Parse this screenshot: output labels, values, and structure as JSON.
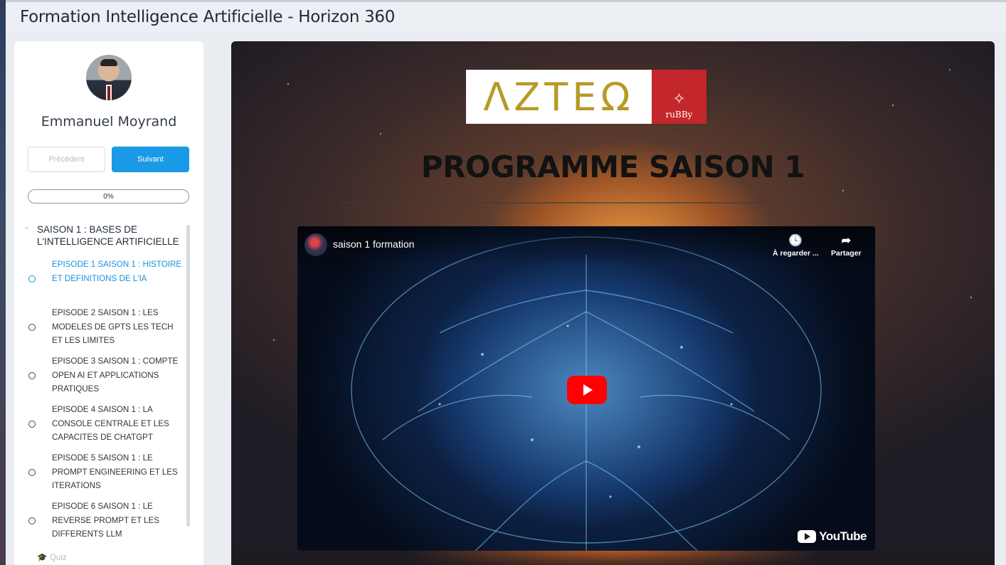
{
  "page": {
    "title": "Formation Intelligence Artificielle - Horizon 360"
  },
  "sidebar": {
    "user_name": "Emmanuel Moyrand",
    "prev_label": "Précédent",
    "next_label": "Suivant",
    "progress": {
      "label": "0%",
      "value": 0
    },
    "section": {
      "title": "SAISON 1 : BASES DE L'INTELLIGENCE ARTIFICIELLE",
      "caret": "ˆ",
      "episodes": [
        {
          "label": "EPISODE 1 SAISON 1 : HISTOIRE ET DEFINITIONS DE L'IA",
          "active": true
        },
        {
          "label": "EPISODE 2 SAISON 1 : LES MODELES DE GPTS LES TECH ET LES LIMITES",
          "active": false
        },
        {
          "label": "EPISODE 3 SAISON 1 : COMPTE OPEN AI ET APPLICATIONS PRATIQUES",
          "active": false
        },
        {
          "label": "EPISODE 4 SAISON 1 : LA CONSOLE CENTRALE ET LES CAPACITES DE CHATGPT",
          "active": false
        },
        {
          "label": "EPISODE 5 SAISON 1 : LE PROMPT ENGINEERING ET LES ITERATIONS",
          "active": false
        },
        {
          "label": "EPISODE 6 SAISON 1 : LE REVERSE PROMPT ET LES DIFFERENTS LLM",
          "active": false
        }
      ]
    },
    "quiz_label": "Quiz",
    "quiz_icon": "graduation-cap-icon"
  },
  "content": {
    "logo": {
      "text": "ΛZTEΩ",
      "badge_text": "ruBBy"
    },
    "heading": "PROGRAMME SAISON 1",
    "video": {
      "title": "saison 1 formation",
      "watch_later_label": "À regarder ...",
      "share_label": "Partager",
      "brand": "YouTube"
    }
  },
  "colors": {
    "accent": "#1a9ae6",
    "logo_gold": "#b79a26",
    "logo_red": "#c3262b",
    "youtube_red": "#ff0000"
  }
}
